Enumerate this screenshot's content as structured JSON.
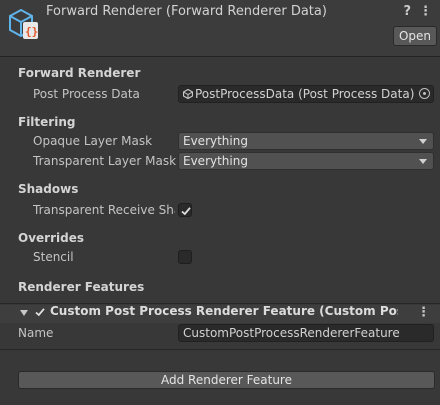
{
  "header": {
    "title": "Forward Renderer (Forward Renderer Data)",
    "asset_icon": "renderer-asset-icon",
    "help_icon": "help-icon",
    "menu_icon": "kebab-menu-icon",
    "open_label": "Open"
  },
  "forward_renderer": {
    "heading": "Forward Renderer",
    "post_process_label": "Post Process Data",
    "post_process_value": "PostProcessData (Post Process Data)"
  },
  "filtering": {
    "heading": "Filtering",
    "opaque_label": "Opaque Layer Mask",
    "opaque_value": "Everything",
    "transparent_label": "Transparent Layer Mask",
    "transparent_value": "Everything"
  },
  "shadows": {
    "heading": "Shadows",
    "receive_label": "Transparent Receive Shadows",
    "receive_checked": true
  },
  "overrides": {
    "heading": "Overrides",
    "stencil_label": "Stencil",
    "stencil_checked": false
  },
  "renderer_features": {
    "heading": "Renderer Features",
    "feature": {
      "title": "Custom Post Process Renderer Feature (Custom Post Process Renderer Feature)",
      "enabled": true,
      "name_label": "Name",
      "name_value": "CustomPostProcessRendererFeature"
    },
    "add_label": "Add Renderer Feature"
  },
  "colors": {
    "background": "#383838",
    "field": "#2a2a2a",
    "button": "#585858"
  }
}
